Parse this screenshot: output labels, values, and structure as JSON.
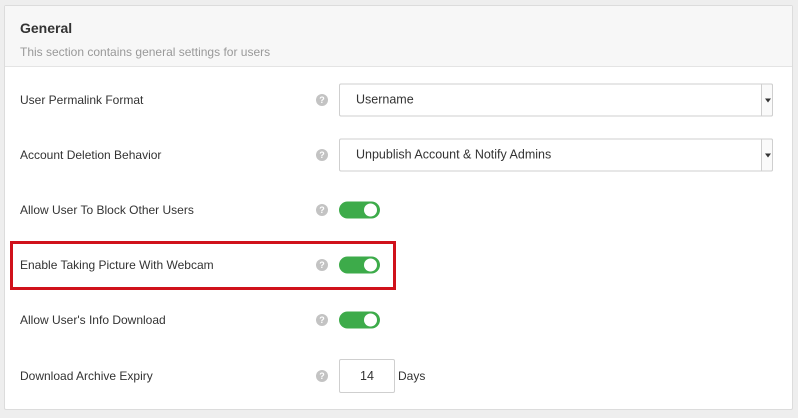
{
  "section": {
    "title": "General",
    "description": "This section contains general settings for users"
  },
  "settings": [
    {
      "label": "User Permalink Format",
      "control": "select",
      "value": "Username"
    },
    {
      "label": "Account Deletion Behavior",
      "control": "select",
      "value": "Unpublish Account & Notify Admins"
    },
    {
      "label": "Allow User To Block Other Users",
      "control": "toggle",
      "state": "on"
    },
    {
      "label": "Enable Taking Picture With Webcam",
      "control": "toggle",
      "state": "on"
    },
    {
      "label": "Allow User's Info Download",
      "control": "toggle",
      "state": "on"
    },
    {
      "label": "Download Archive Expiry",
      "control": "number",
      "value": "14",
      "unit": "Days"
    }
  ],
  "help_icon": {
    "name": "question-circle-icon",
    "glyph": "?"
  },
  "colors": {
    "toggle_on": "#3dab4a",
    "highlight_border": "#d0111b",
    "header_bg": "#f7f7f7"
  }
}
